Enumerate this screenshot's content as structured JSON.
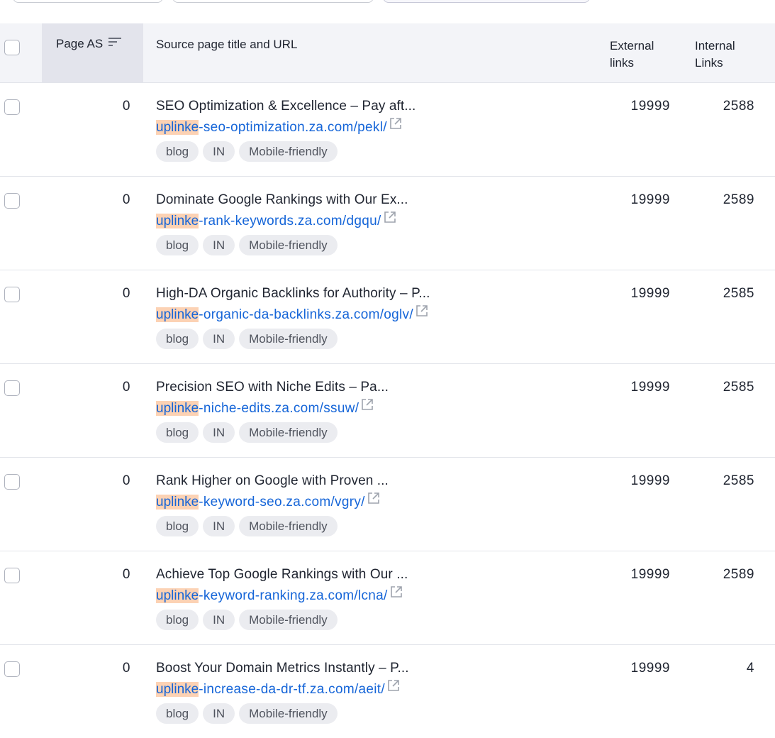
{
  "columns": {
    "page_as": "Page AS",
    "source": "Source page title and URL",
    "external_line1": "External",
    "external_line2": "links",
    "internal_line1": "Internal",
    "internal_line2": "Links"
  },
  "colors": {
    "url": "#1565d8",
    "highlight": "#fcd2b4",
    "header_bg": "#f3f4f8",
    "sorted_header_bg": "#e3e4ec",
    "tag_bg": "#ebecf0"
  },
  "icons": {
    "sort": "sort-lines-icon",
    "external": "external-link-icon"
  },
  "rows": [
    {
      "page_as": "0",
      "title": "SEO Optimization & Excellence – Pay aft...",
      "url_highlight": "uplinke",
      "url_rest": "-seo-optimization.za.com/pekl/",
      "tags": [
        "blog",
        "IN",
        "Mobile-friendly"
      ],
      "external_links": "19999",
      "internal_links": "2588"
    },
    {
      "page_as": "0",
      "title": "Dominate Google Rankings with Our Ex...",
      "url_highlight": "uplinke",
      "url_rest": "-rank-keywords.za.com/dgqu/",
      "tags": [
        "blog",
        "IN",
        "Mobile-friendly"
      ],
      "external_links": "19999",
      "internal_links": "2589"
    },
    {
      "page_as": "0",
      "title": "High-DA Organic Backlinks for Authority – P...",
      "url_highlight": "uplinke",
      "url_rest": "-organic-da-backlinks.za.com/oglv/",
      "tags": [
        "blog",
        "IN",
        "Mobile-friendly"
      ],
      "external_links": "19999",
      "internal_links": "2585"
    },
    {
      "page_as": "0",
      "title": "Precision SEO with Niche Edits – Pa...",
      "url_highlight": "uplinke",
      "url_rest": "-niche-edits.za.com/ssuw/",
      "tags": [
        "blog",
        "IN",
        "Mobile-friendly"
      ],
      "external_links": "19999",
      "internal_links": "2585"
    },
    {
      "page_as": "0",
      "title": "Rank Higher on Google with Proven ...",
      "url_highlight": "uplinke",
      "url_rest": "-keyword-seo.za.com/vgry/",
      "tags": [
        "blog",
        "IN",
        "Mobile-friendly"
      ],
      "external_links": "19999",
      "internal_links": "2585"
    },
    {
      "page_as": "0",
      "title": "Achieve Top Google Rankings with Our ...",
      "url_highlight": "uplinke",
      "url_rest": "-keyword-ranking.za.com/lcna/",
      "tags": [
        "blog",
        "IN",
        "Mobile-friendly"
      ],
      "external_links": "19999",
      "internal_links": "2589"
    },
    {
      "page_as": "0",
      "title": "Boost Your Domain Metrics Instantly – P...",
      "url_highlight": "uplinke",
      "url_rest": "-increase-da-dr-tf.za.com/aeit/",
      "tags": [
        "blog",
        "IN",
        "Mobile-friendly"
      ],
      "external_links": "19999",
      "internal_links": "4"
    }
  ]
}
